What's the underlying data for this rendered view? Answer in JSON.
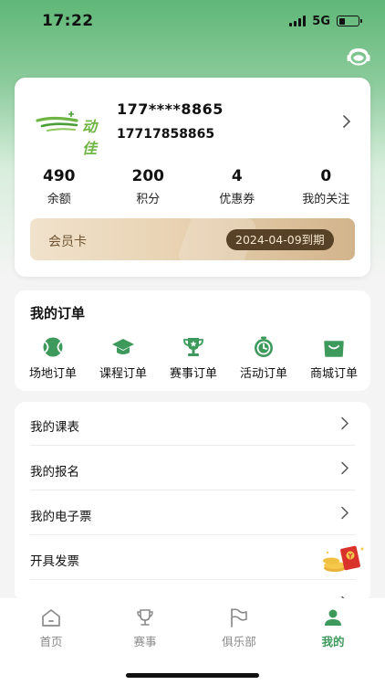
{
  "status_bar": {
    "time": "17:22",
    "network": "5G",
    "battery_level": 0.3
  },
  "header": {
    "support_icon": "headset-support-icon"
  },
  "profile": {
    "logo_text": "动佳",
    "phone_masked": "177****8865",
    "phone_full": "17717858865",
    "stats": [
      {
        "value": "490",
        "label": "余额"
      },
      {
        "value": "200",
        "label": "积分"
      },
      {
        "value": "4",
        "label": "优惠券"
      },
      {
        "value": "0",
        "label": "我的关注"
      }
    ],
    "member_card": {
      "label": "会员卡",
      "expiry": "2024-04-09到期"
    }
  },
  "orders": {
    "title": "我的订单",
    "items": [
      {
        "label": "场地订单",
        "icon": "tennis-ball-icon"
      },
      {
        "label": "课程订单",
        "icon": "graduation-cap-icon"
      },
      {
        "label": "赛事订单",
        "icon": "trophy-icon"
      },
      {
        "label": "活动订单",
        "icon": "stopwatch-icon"
      },
      {
        "label": "商城订单",
        "icon": "shopping-bag-icon"
      }
    ]
  },
  "menu": {
    "items": [
      {
        "label": "我的课表"
      },
      {
        "label": "我的报名"
      },
      {
        "label": "我的电子票"
      },
      {
        "label": "开具发票"
      }
    ]
  },
  "tab_bar": {
    "tabs": [
      {
        "label": "首页",
        "icon": "home-icon"
      },
      {
        "label": "赛事",
        "icon": "trophy-icon"
      },
      {
        "label": "俱乐部",
        "icon": "flag-icon"
      },
      {
        "label": "我的",
        "icon": "person-icon"
      }
    ],
    "active_index": 3,
    "colors": {
      "active": "#3e9a5c",
      "inactive": "#8a8a8a"
    }
  },
  "colors": {
    "brand_green": "#3e9a5c",
    "member_badge": "#574227"
  }
}
